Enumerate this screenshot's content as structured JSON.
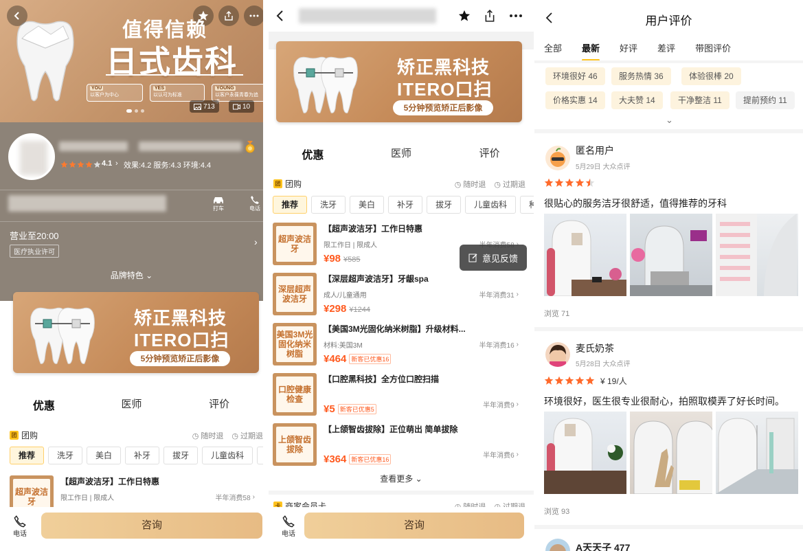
{
  "panel1": {
    "hero": {
      "title_line1": "值得信赖",
      "title_line2": "日式齿科",
      "chips": [
        {
          "tag": "YOU",
          "text": "以客户为中心"
        },
        {
          "tag": "YES",
          "text": "以认可为标准"
        },
        {
          "tag": "YOUNG",
          "text": "以客户永葆青春为追求"
        }
      ],
      "photo_count": "713",
      "video_count": "10"
    },
    "info": {
      "rating": "4.1",
      "stars": 4,
      "scores": "效果:4.2  服务:4.3  环境:4.4",
      "taxi_label": "打车",
      "phone_label": "电话",
      "hours": "营业至20:00",
      "license": "医疗执业许可",
      "brand_features": "品牌特色"
    },
    "banner": {
      "line1": "矫正黑科技",
      "line2": "ITERO口扫",
      "line3": "5分钟预览矫正后影像"
    },
    "tabs": [
      "优惠",
      "医师",
      "评价"
    ],
    "group": {
      "badge": "团",
      "label": "团购",
      "refund_any": "随时退",
      "refund_expire": "过期退"
    },
    "categories": [
      "推荐",
      "洗牙",
      "美白",
      "补牙",
      "拔牙",
      "儿童齿科",
      "种"
    ],
    "deal": {
      "thumb": "超声波洁牙",
      "title": "【超声波洁牙】工作日特惠",
      "sub": "限工作日 | 限成人",
      "sold": "半年消费58"
    },
    "bottom": {
      "call": "电话",
      "consult": "咨询"
    }
  },
  "panel2": {
    "banner": {
      "line1": "矫正黑科技",
      "line2": "ITERO口扫",
      "line3": "5分钟预览矫正后影像"
    },
    "tabs": [
      "优惠",
      "医师",
      "评价"
    ],
    "group": {
      "badge": "团",
      "label": "团购",
      "refund_any": "随时退",
      "refund_expire": "过期退"
    },
    "categories": [
      "推荐",
      "洗牙",
      "美白",
      "补牙",
      "拔牙",
      "儿童齿科",
      "种"
    ],
    "deals": [
      {
        "thumb": "超声波洁牙",
        "title": "【超声波洁牙】工作日特惠",
        "sub": "限工作日 | 限成人",
        "sold": "半年消费58",
        "price": "¥98",
        "old": "¥585",
        "badge": ""
      },
      {
        "thumb": "深层超声波洁牙",
        "title": "【深层超声波洁牙】牙龈spa",
        "sub": "成人/儿童通用",
        "sold": "半年消费31",
        "price": "¥298",
        "old": "¥1244",
        "badge": ""
      },
      {
        "thumb": "美国3M光固化纳米树脂",
        "title": "【美国3M光固化纳米树脂】升级材料...",
        "sub": "材料:美国3M",
        "sold": "半年消费16",
        "price": "¥464",
        "old": "",
        "badge": "新客已优惠16"
      },
      {
        "thumb": "口腔健康检查",
        "title": "【口腔黑科技】全方位口腔扫描",
        "sub": "",
        "sold": "半年消费9",
        "price": "¥5",
        "old": "",
        "badge": "新客已优惠5"
      },
      {
        "thumb": "上颌智齿拔除",
        "title": "【上颌智齿拔除】正位萌出 简单拔除",
        "sub": "",
        "sold": "半年消费6",
        "price": "¥364",
        "old": "",
        "badge": "新客已优惠16"
      }
    ],
    "feedback": "意见反馈",
    "more": "查看更多",
    "next_section": "商家会员卡",
    "next_refund_any": "随时退",
    "next_refund_expire": "过期退",
    "bottom": {
      "call": "电话",
      "consult": "咨询"
    }
  },
  "panel3": {
    "title": "用户评价",
    "tabs": [
      "全部",
      "最新",
      "好评",
      "差评",
      "带图评价"
    ],
    "tags_row1": [
      "环境很好 46",
      "服务热情 36",
      "体验很棒 20"
    ],
    "tags_row2": [
      "价格实惠 14",
      "大夫赞 14",
      "干净整洁 11",
      "提前预约 11"
    ],
    "reviews": [
      {
        "name": "匿名用户",
        "meta": "5月29日 大众点评",
        "stars": 4.5,
        "price": "",
        "text": "很贴心的服务洁牙很舒适，值得推荐的牙科",
        "views": "浏览 71"
      },
      {
        "name": "麦氏奶茶",
        "meta": "5月28日 大众点评",
        "stars": 5,
        "price": "¥ 19/人",
        "text": "环境很好，医生很专业很耐心，拍照取模弄了好长时间。",
        "views": "浏览 93"
      },
      {
        "name": "A天天子 477",
        "meta": "",
        "stars": 0,
        "price": "",
        "text": "",
        "views": ""
      }
    ]
  },
  "colors": {
    "accent": "#ffc31f",
    "price": "#ff5a1f",
    "banner": "#c58a58",
    "star": "#ff6a2b"
  }
}
